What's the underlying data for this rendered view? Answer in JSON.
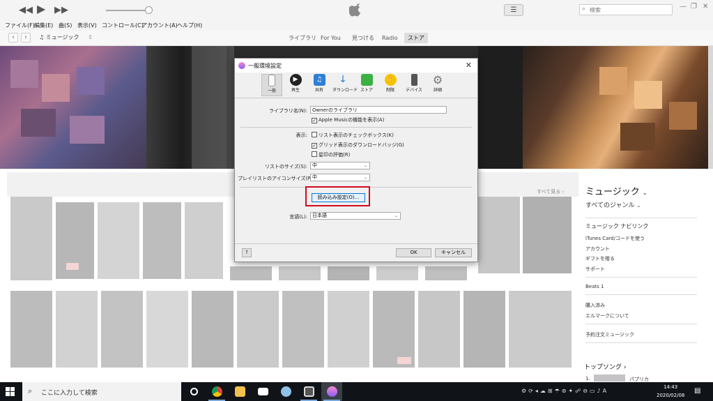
{
  "search": {
    "placeholder": "検索"
  },
  "menu": [
    "ファイル(F)",
    "編集(E)",
    "曲(S)",
    "表示(V)",
    "コントロール(C)",
    "アカウント(A)",
    "ヘルプ(H)"
  ],
  "nav": {
    "media": "ミュージック",
    "tabs": [
      "ライブラリ",
      "For You",
      "見つける",
      "Radio",
      "ストア"
    ],
    "active_tab": "ストア"
  },
  "store": {
    "see_all": "すべて見る ›",
    "sidebar": {
      "title": "ミュージック",
      "genre": "すべてのジャンル",
      "nav_title": "ミュージック ナビリンク",
      "links": [
        "iTunes Card/コードを使う",
        "アカウント",
        "ギフトを贈る",
        "サポート"
      ],
      "beats": "Beats 1",
      "links2": [
        "購入済み",
        "エルマークについて"
      ],
      "preorder": "予約注文ミュージック",
      "top_songs": "トップソング",
      "top1_num": "1.",
      "top1_artist": "パプリカ"
    }
  },
  "dialog": {
    "title": "一般環境設定",
    "tools": [
      "一般",
      "再生",
      "共有",
      "ダウンロード",
      "ストア",
      "制限",
      "デバイス",
      "詳細"
    ],
    "library_label": "ライブラリ名(N):",
    "library_value": "Ownerのライブラリ",
    "apple_music_chk": "Apple Musicの機能を表示(A)",
    "display_label": "表示:",
    "chk_list": "リスト表示のチェックボックス(K)",
    "chk_grid": "グリッド表示のダウンロードバッジ(G)",
    "chk_stars": "星印の評価(R)",
    "list_size_label": "リストのサイズ(S):",
    "list_size_value": "中",
    "playlist_icon_label": "プレイリストのアイコンサイズ(P):",
    "playlist_icon_value": "中",
    "import_btn": "読み込み設定(O)...",
    "lang_label": "言語(L):",
    "lang_value": "日本語",
    "help_btn": "?",
    "ok_btn": "OK",
    "cancel_btn": "キャンセル"
  },
  "taskbar": {
    "search_text": "ここに入力して検索",
    "time": "14:43",
    "date": "2020/02/08"
  },
  "colors": {
    "highlight": "#d20a1e",
    "taskbar": "#101318"
  }
}
